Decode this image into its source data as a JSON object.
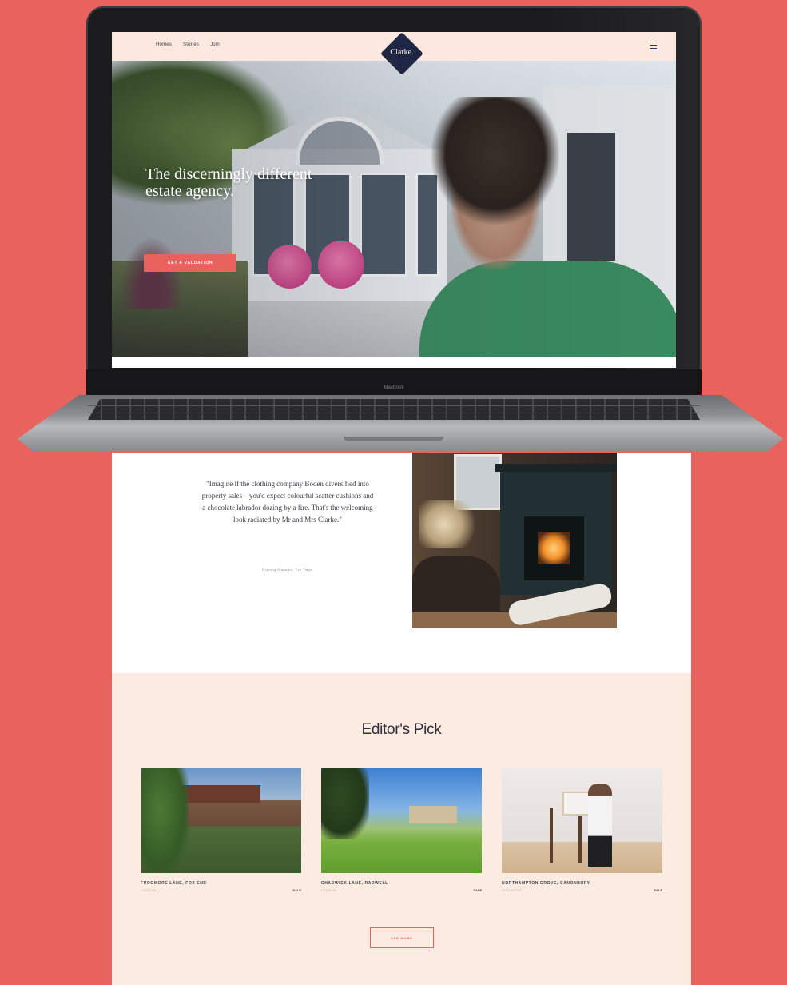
{
  "site": {
    "brand": "Clarke.",
    "nav": [
      "Homes",
      "Stories",
      "Join"
    ],
    "hero_headline_line1": "The discerningly different",
    "hero_headline_line2": "estate agency.",
    "cta_label": "GET A VALUATION"
  },
  "laptop": {
    "label": "MacBook"
  },
  "quote": {
    "text": "\"Imagine if the clothing company Boden diversified into property sales – you'd expect colourful scatter cushions and a chocolate labrador dozing by a fire. That's the welcoming look radiated by Mr and Mrs Clarke.\"",
    "source": "Evening Standard, The Times"
  },
  "editors_pick": {
    "title": "Editor's Pick",
    "cards": [
      {
        "name": "FROGMORE LANE, FOX END",
        "area": "LONDON",
        "status": "SALE"
      },
      {
        "name": "CHADWICK LANE, RADWELL",
        "area": "LONDON",
        "status": "SALE"
      },
      {
        "name": "NORTHAMPTON GROVE, CANONBURY",
        "area": "ISLINGTON",
        "status": "SALE"
      }
    ],
    "see_more_label": "SEE MORE"
  },
  "colors": {
    "background": "#e8625e",
    "accent": "#e8625e",
    "brand_navy": "#202745",
    "section_cream": "#fcebe0"
  },
  "icons": [
    "menu-icon",
    "brand-diamond-logo"
  ]
}
